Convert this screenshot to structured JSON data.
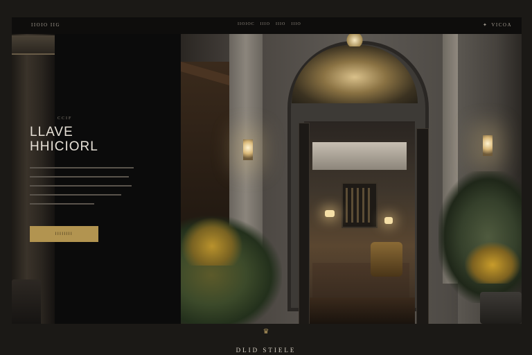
{
  "header": {
    "brand": "IIOIO IIG",
    "nav": [
      "IIOIOC",
      "IIIO",
      "IIIO",
      "IIIO"
    ],
    "right_label": "VICOA"
  },
  "hero": {
    "eyebrow": "CCIF",
    "headline_line1": "LLAVE",
    "headline_line2": "HHICIORL",
    "cta_label": "IIIIIIII"
  },
  "footer": {
    "logo_name": "DLID STIELE"
  },
  "colors": {
    "accent_gold": "#b29450",
    "background": "#0d0c0b",
    "headline": "#e6e0d6"
  },
  "icons": [
    "crest-icon"
  ]
}
